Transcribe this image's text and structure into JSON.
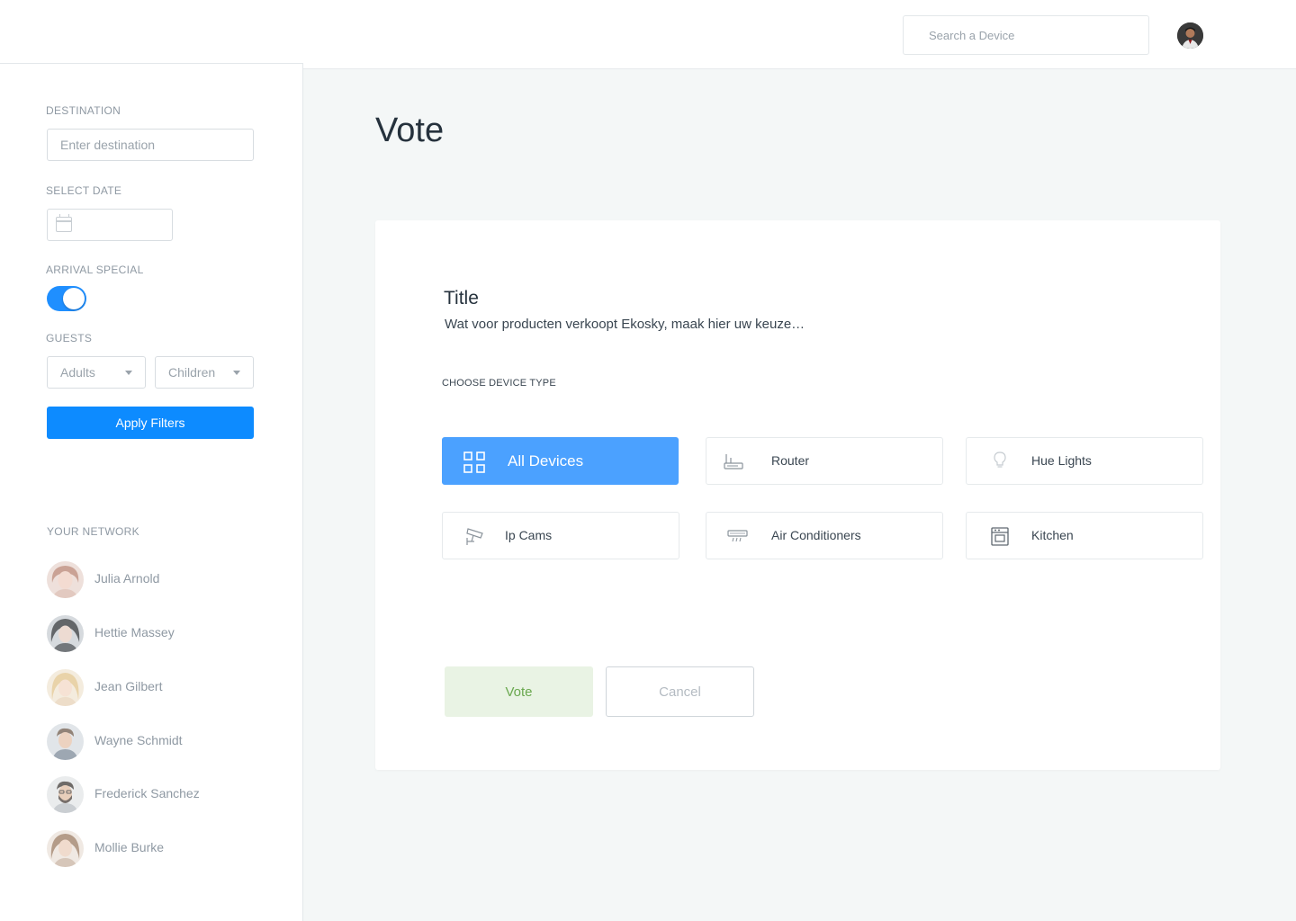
{
  "header": {
    "search_placeholder": "Search a Device"
  },
  "sidebar": {
    "destination_label": "DESTINATION",
    "destination_placeholder": "Enter destination",
    "date_label": "SELECT DATE",
    "arrival_label": "ARRIVAL SPECIAL",
    "arrival_on": true,
    "guests_label": "GUESTS",
    "adults": "Adults",
    "children": "Children",
    "apply_label": "Apply Filters",
    "network_label": "YOUR NETWORK",
    "network": [
      {
        "name": "Julia Arnold"
      },
      {
        "name": "Hettie Massey"
      },
      {
        "name": "Jean Gilbert"
      },
      {
        "name": "Wayne Schmidt"
      },
      {
        "name": "Frederick Sanchez"
      },
      {
        "name": "Mollie Burke"
      }
    ]
  },
  "main": {
    "page_title": "Vote",
    "card": {
      "title": "Title",
      "description": "Wat voor producten verkoopt Ekosky, maak hier uw keuze…",
      "section_label": "CHOOSE DEVICE TYPE",
      "devices": [
        {
          "label": "All Devices",
          "icon": "grid-icon",
          "active": true
        },
        {
          "label": "Router",
          "icon": "router-icon",
          "active": false
        },
        {
          "label": "Hue Lights",
          "icon": "lightbulb-icon",
          "active": false
        },
        {
          "label": "Ip Cams",
          "icon": "camera-icon",
          "active": false
        },
        {
          "label": "Air Conditioners",
          "icon": "air-conditioner-icon",
          "active": false
        },
        {
          "label": "Kitchen",
          "icon": "kitchen-icon",
          "active": false
        }
      ],
      "vote_label": "Vote",
      "cancel_label": "Cancel"
    }
  },
  "colors": {
    "accent": "#0d8bff",
    "active_tile": "#4ba1ff",
    "vote_bg": "#e9f3e4",
    "vote_text": "#6aa84f"
  }
}
